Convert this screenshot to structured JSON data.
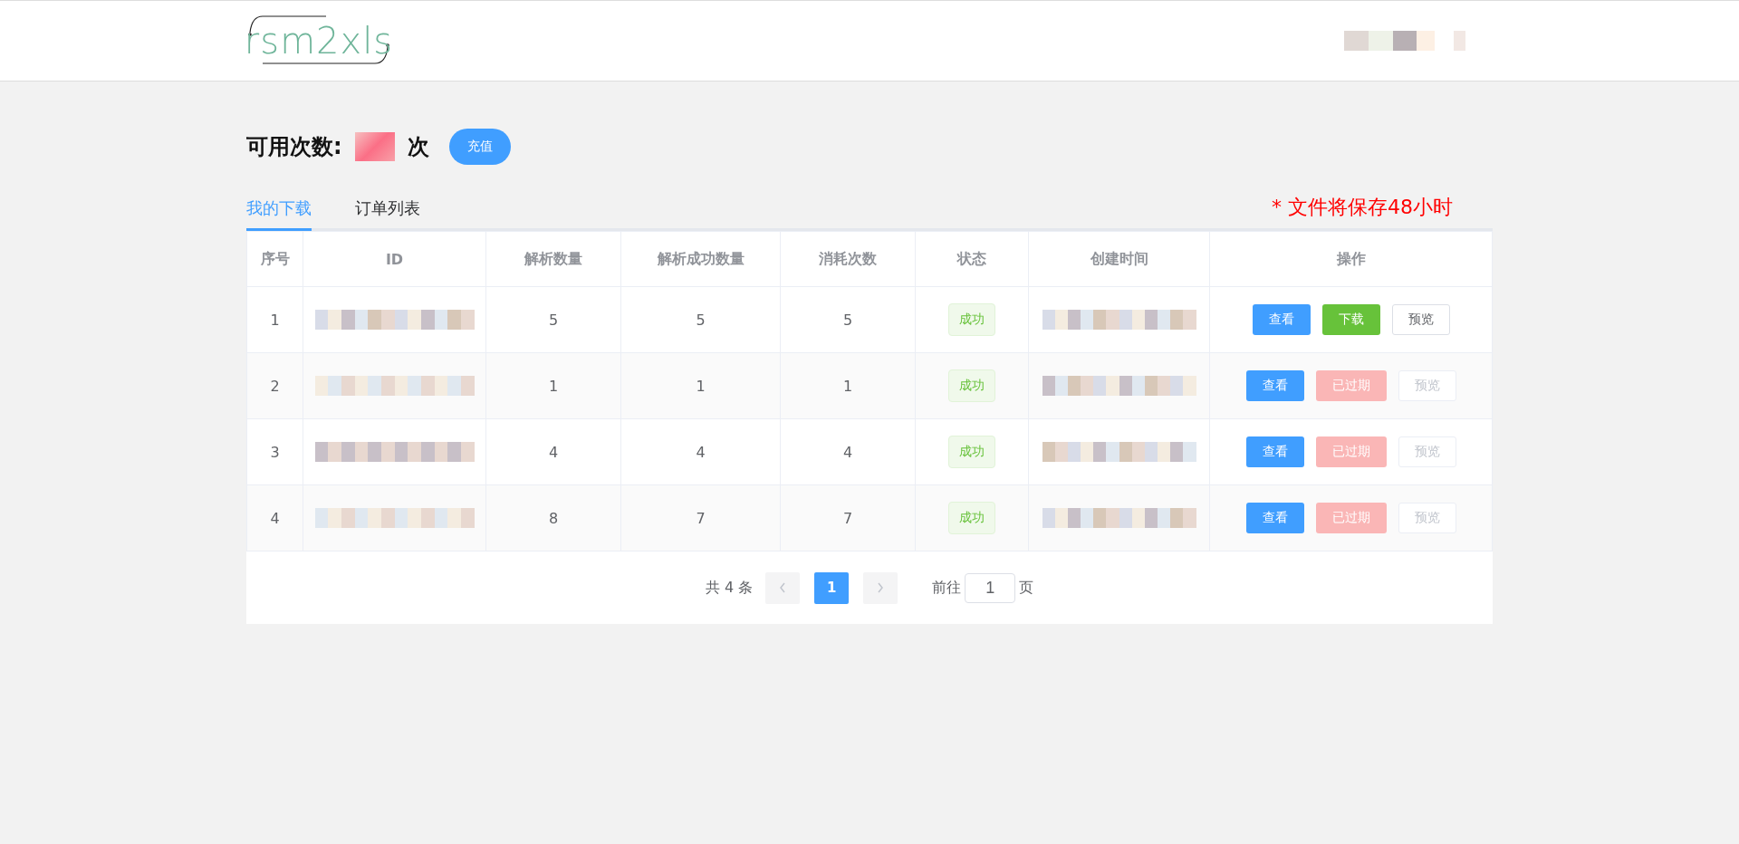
{
  "header": {
    "logo": "rsm2xls"
  },
  "balance": {
    "label": "可用次数:",
    "unit": "次",
    "recharge_button": "充值"
  },
  "tabs": [
    {
      "label": "我的下载",
      "selected": true
    },
    {
      "label": "订单列表",
      "selected": false
    }
  ],
  "notice": "* 文件将保存48小时",
  "table": {
    "columns": [
      "序号",
      "ID",
      "解析数量",
      "解析成功数量",
      "消耗次数",
      "状态",
      "创建时间",
      "操作"
    ],
    "rows": [
      {
        "index": "1",
        "parsed": "5",
        "parsed_success": "5",
        "consumed": "5",
        "status": "成功",
        "actions": [
          {
            "label": "查看",
            "kind": "primary",
            "disabled": false
          },
          {
            "label": "下载",
            "kind": "success",
            "disabled": false
          },
          {
            "label": "预览",
            "kind": "plain",
            "disabled": false
          }
        ]
      },
      {
        "index": "2",
        "parsed": "1",
        "parsed_success": "1",
        "consumed": "1",
        "status": "成功",
        "actions": [
          {
            "label": "查看",
            "kind": "primary",
            "disabled": false
          },
          {
            "label": "已过期",
            "kind": "danger",
            "disabled": true
          },
          {
            "label": "预览",
            "kind": "plain",
            "disabled": true
          }
        ]
      },
      {
        "index": "3",
        "parsed": "4",
        "parsed_success": "4",
        "consumed": "4",
        "status": "成功",
        "actions": [
          {
            "label": "查看",
            "kind": "primary",
            "disabled": false
          },
          {
            "label": "已过期",
            "kind": "danger",
            "disabled": true
          },
          {
            "label": "预览",
            "kind": "plain",
            "disabled": true
          }
        ]
      },
      {
        "index": "4",
        "parsed": "8",
        "parsed_success": "7",
        "consumed": "7",
        "status": "成功",
        "actions": [
          {
            "label": "查看",
            "kind": "primary",
            "disabled": false
          },
          {
            "label": "已过期",
            "kind": "danger",
            "disabled": true
          },
          {
            "label": "预览",
            "kind": "plain",
            "disabled": true
          }
        ]
      }
    ]
  },
  "pagination": {
    "total": "共 4 条",
    "pages": [
      {
        "label": "1",
        "selected": true
      }
    ],
    "goto_label": "前往",
    "goto_value": "1",
    "goto_suffix": "页"
  }
}
